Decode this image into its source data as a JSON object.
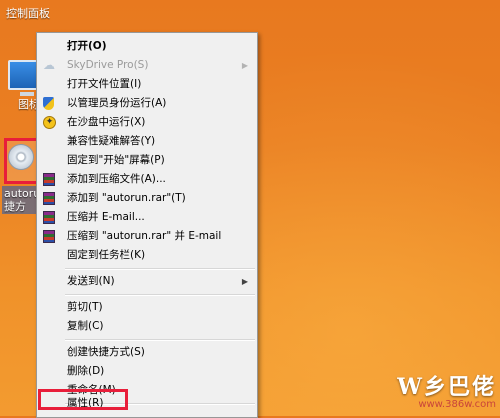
{
  "desktop": {
    "top_label": "控制面板",
    "icons": [
      {
        "label": "图标"
      },
      {
        "label": "autorun 捷方"
      }
    ]
  },
  "context_menu": {
    "items": [
      {
        "label": "打开(O)",
        "bold": true,
        "icon": ""
      },
      {
        "label": "SkyDrive Pro(S)",
        "disabled": true,
        "submenu": true,
        "icon": "cloud-icon"
      },
      {
        "label": "打开文件位置(I)",
        "icon": ""
      },
      {
        "label": "以管理员身份运行(A)",
        "icon": "uac-shield-icon"
      },
      {
        "label": "在沙盘中运行(X)",
        "icon": "sandbox-icon"
      },
      {
        "label": "兼容性疑难解答(Y)",
        "icon": ""
      },
      {
        "label": "固定到\"开始\"屏幕(P)",
        "icon": ""
      },
      {
        "label": "添加到压缩文件(A)...",
        "icon": "winrar-icon"
      },
      {
        "label": "添加到 \"autorun.rar\"(T)",
        "icon": "winrar-icon"
      },
      {
        "label": "压缩并 E-mail...",
        "icon": "winrar-icon"
      },
      {
        "label": "压缩到 \"autorun.rar\" 并 E-mail",
        "icon": "winrar-icon"
      },
      {
        "label": "固定到任务栏(K)",
        "icon": ""
      },
      {
        "label": "发送到(N)",
        "submenu": true,
        "icon": ""
      },
      {
        "label": "剪切(T)",
        "icon": ""
      },
      {
        "label": "复制(C)",
        "icon": ""
      },
      {
        "label": "创建快捷方式(S)",
        "icon": ""
      },
      {
        "label": "删除(D)",
        "icon": ""
      },
      {
        "label": "重命名(M)",
        "icon": ""
      },
      {
        "label": "属性(R)",
        "icon": ""
      }
    ],
    "submenu_arrow": "▶"
  },
  "watermark": {
    "logo": "W乡巴佬",
    "url": "www.386w.com"
  },
  "colors": {
    "desktop_orange": "#ea7f22",
    "highlight_red": "#e81e3a",
    "menu_bg": "#f0f0f0"
  }
}
